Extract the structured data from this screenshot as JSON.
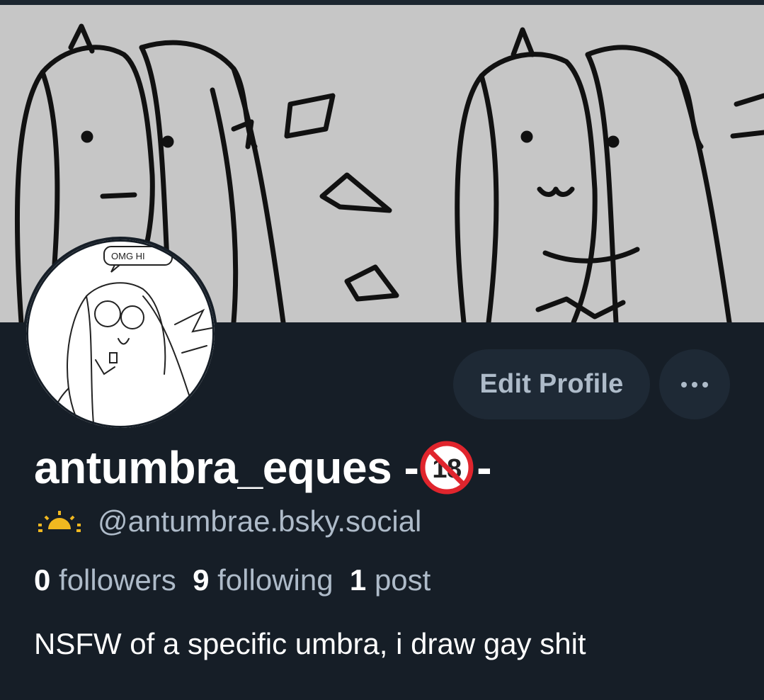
{
  "profile": {
    "display_name": "antumbra_eques -",
    "display_name_suffix": "-",
    "handle": "@antumbrae.bsky.social",
    "bio": "NSFW of a specific umbra, i draw gay shit",
    "avatar_speech": "OMG HI",
    "badge_icon": "no-under-18-icon",
    "handle_icon": "sunrise-icon"
  },
  "stats": {
    "followers_count": "0",
    "followers_label": "followers",
    "following_count": "9",
    "following_label": "following",
    "posts_count": "1",
    "posts_label": "post"
  },
  "actions": {
    "edit_label": "Edit Profile",
    "more_icon": "ellipsis-icon"
  },
  "colors": {
    "background": "#161e27",
    "button_bg": "#1e2935",
    "muted_text": "#aebbc9",
    "banner_bg": "#c6c6c6"
  }
}
